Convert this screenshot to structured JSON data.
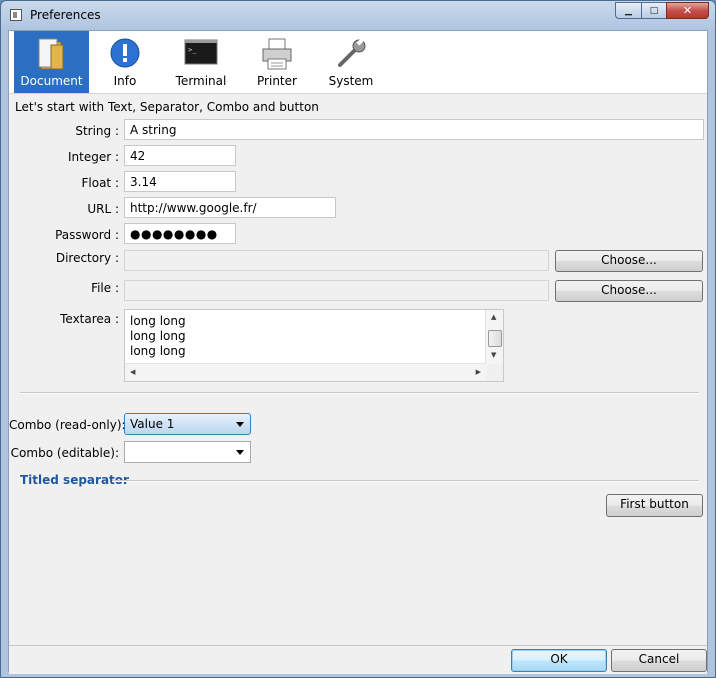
{
  "window": {
    "title": "Preferences"
  },
  "tabs": [
    {
      "label": "Document",
      "icon": "document-icon",
      "selected": true
    },
    {
      "label": "Info",
      "icon": "info-icon",
      "selected": false
    },
    {
      "label": "Terminal",
      "icon": "terminal-icon",
      "selected": false
    },
    {
      "label": "Printer",
      "icon": "printer-icon",
      "selected": false
    },
    {
      "label": "System",
      "icon": "wrench-icon",
      "selected": false
    }
  ],
  "section": {
    "title": "Let's start with Text, Separator, Combo and button"
  },
  "fields": {
    "string": {
      "label": "String :",
      "value": "A string"
    },
    "integer": {
      "label": "Integer :",
      "value": "42"
    },
    "float": {
      "label": "Float :",
      "value": "3.14"
    },
    "url": {
      "label": "URL :",
      "value": "http://www.google.fr/"
    },
    "password": {
      "label": "Password :",
      "value": "●●●●●●●●"
    },
    "directory": {
      "label": "Directory :",
      "value": "",
      "button": "Choose..."
    },
    "file": {
      "label": "File :",
      "value": "",
      "button": "Choose..."
    },
    "textarea": {
      "label": "Textarea :",
      "lines": [
        "long long",
        "long long",
        "long long"
      ]
    }
  },
  "combos": {
    "readonly": {
      "label": "Combo (read-only):",
      "value": "Value 1"
    },
    "editable": {
      "label": "Combo (editable):",
      "value": ""
    }
  },
  "titled_separator": "Titled separator",
  "first_button": "First button",
  "dialog_buttons": {
    "ok": "OK",
    "cancel": "Cancel"
  },
  "colors": {
    "selected_tab": "#2a6fc2",
    "titled_separator": "#1f5aa0"
  }
}
